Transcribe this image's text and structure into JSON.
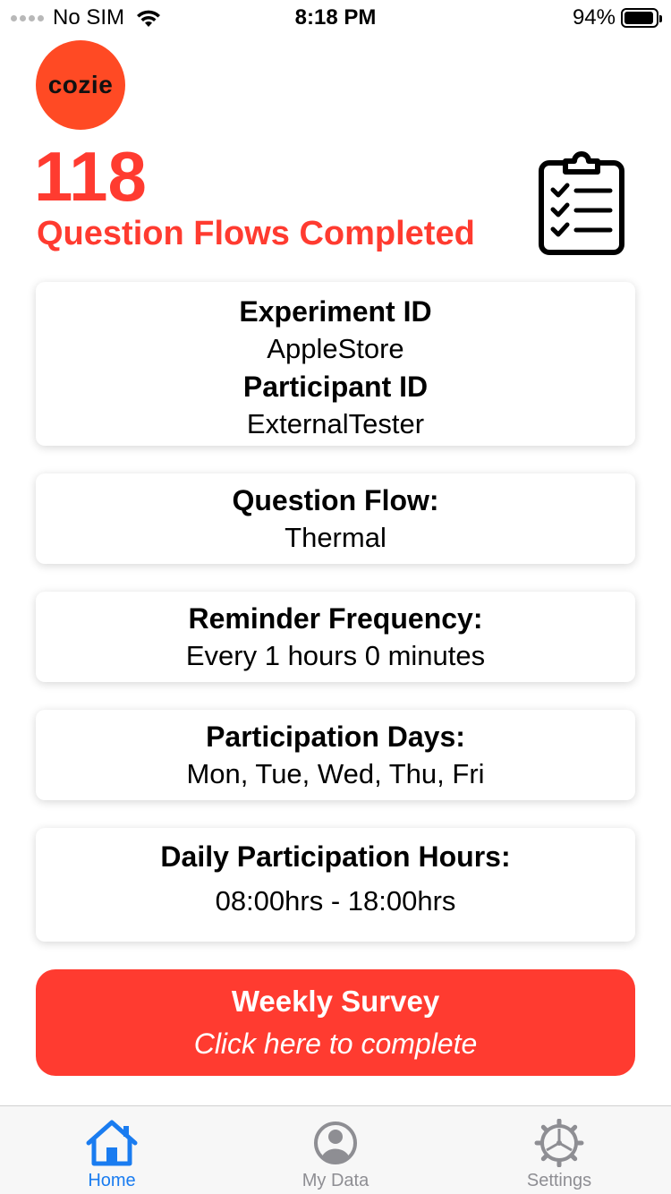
{
  "status_bar": {
    "carrier": "No SIM",
    "time": "8:18 PM",
    "battery_percent": "94%",
    "battery_level": 0.94
  },
  "logo": {
    "text": "cozie",
    "color": "#ff4a24"
  },
  "summary": {
    "count": "118",
    "label": "Question Flows Completed",
    "icon": "clipboard-checklist-icon",
    "accent_color": "#ff3b30"
  },
  "cards": {
    "experiment_id_title": "Experiment ID",
    "experiment_id_value": "AppleStore",
    "participant_id_title": "Participant ID",
    "participant_id_value": "ExternalTester",
    "question_flow_title": "Question Flow:",
    "question_flow_value": "Thermal",
    "reminder_title": "Reminder Frequency:",
    "reminder_value": "Every 1 hours 0 minutes",
    "days_title": "Participation Days:",
    "days_value": "Mon, Tue, Wed, Thu, Fri",
    "hours_title": "Daily Participation Hours:",
    "hours_value": "08:00hrs - 18:00hrs"
  },
  "survey_button": {
    "title": "Weekly Survey",
    "subtitle": "Click here to complete",
    "color": "#ff3b30"
  },
  "tab_bar": {
    "active_color": "#1a7cf0",
    "inactive_color": "#8e8e93",
    "tabs": [
      {
        "label": "Home",
        "icon": "home-icon",
        "active": true
      },
      {
        "label": "My Data",
        "icon": "person-circle-icon",
        "active": false
      },
      {
        "label": "Settings",
        "icon": "gear-icon",
        "active": false
      }
    ]
  }
}
